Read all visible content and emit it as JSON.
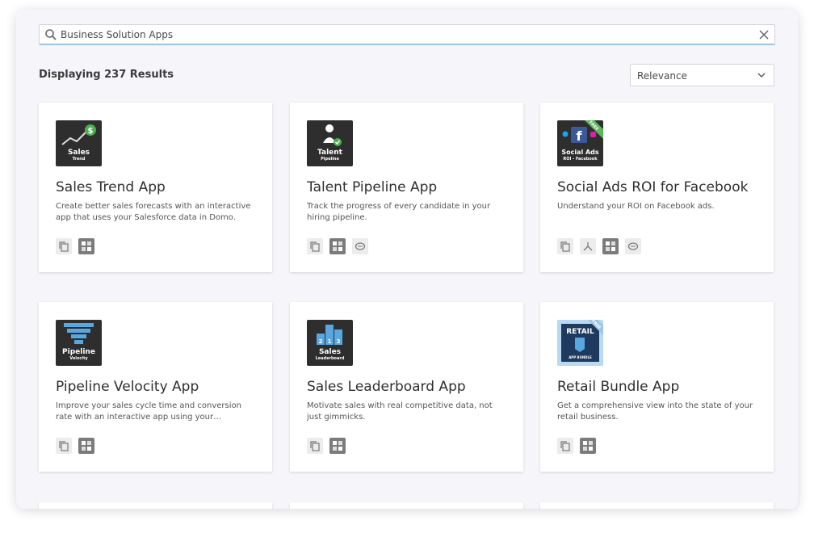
{
  "search": {
    "query": "Business Solution Apps"
  },
  "results_label": "Displaying 237 Results",
  "sort": {
    "selected": "Relevance"
  },
  "colors": {
    "accent": "#9cc4e6",
    "thumb_dark": "#2e2e2e",
    "trend_green": "#4caf50",
    "funnel_blue": "#5aa7e0",
    "retail_blue": "#1f5f9e"
  },
  "cards": [
    {
      "title": "Sales Trend App",
      "desc": "Create better sales forecasts with an interactive app that uses your Salesforce data in Domo.",
      "thumb": {
        "label": "Sales",
        "sub": "Trend"
      },
      "badges": [
        "copy-icon",
        "app-icon"
      ]
    },
    {
      "title": "Talent Pipeline App",
      "desc": "Track the progress of every candidate in your hiring pipeline.",
      "thumb": {
        "label": "Talent",
        "sub": "Pipeline"
      },
      "badges": [
        "copy-icon",
        "app-icon",
        "chat-icon"
      ]
    },
    {
      "title": "Social Ads ROI for Facebook",
      "desc": "Understand your ROI on Facebook ads.",
      "thumb": {
        "label": "Social Ads",
        "sub": "ROI - Facebook",
        "ribbon": "FREE"
      },
      "badges": [
        "copy-icon",
        "connector-icon",
        "app-icon",
        "chat-icon"
      ]
    },
    {
      "title": "Pipeline Velocity App",
      "desc": "Improve your sales cycle time and conversion rate with an interactive app using your Salesforce data in Domo.",
      "thumb": {
        "label": "Pipeline",
        "sub": "Velocity"
      },
      "badges": [
        "copy-icon",
        "app-icon"
      ]
    },
    {
      "title": "Sales Leaderboard App",
      "desc": "Motivate sales with real competitive data, not just gimmicks.",
      "thumb": {
        "label": "Sales",
        "sub": "Leaderboard"
      },
      "badges": [
        "copy-icon",
        "app-icon"
      ]
    },
    {
      "title": "Retail Bundle App",
      "desc": "Get a comprehensive view into the state of your retail business.",
      "thumb": {
        "label": "RETAIL",
        "sub": "APP BUNDLE",
        "ribbon": "FREE"
      },
      "badges": [
        "copy-icon",
        "app-icon"
      ]
    }
  ]
}
